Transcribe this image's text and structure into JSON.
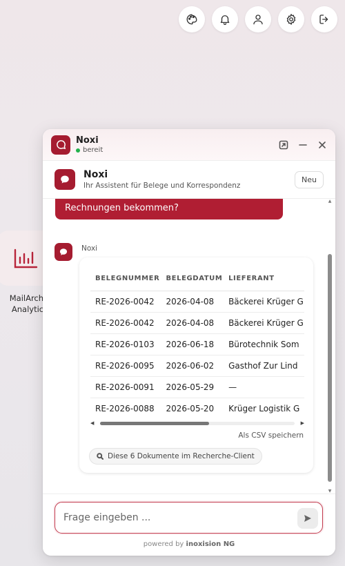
{
  "topbar": {
    "icons": [
      "palette-icon",
      "bell-icon",
      "user-icon",
      "gear-icon",
      "logout-icon"
    ]
  },
  "desktop": {
    "app_tile": {
      "label_line1": "MailArchi",
      "label_line2": "Analytic",
      "icon": "bar-chart-icon"
    }
  },
  "chat": {
    "header": {
      "title": "Noxi",
      "status": "bereit"
    },
    "assistant": {
      "name": "Noxi",
      "subtitle": "Ihr Assistent für Belege und Korrespondenz",
      "new_button": "Neu"
    },
    "user_message": "Rechnungen bekommen?",
    "bot_name": "Noxi",
    "table": {
      "columns": [
        "BELEGNUMMER",
        "BELEGDATUM",
        "LIEFERANT"
      ],
      "rows": [
        [
          "RE-2026-0042",
          "2026-04-08",
          "Bäckerei Krüger G"
        ],
        [
          "RE-2026-0042",
          "2026-04-08",
          "Bäckerei Krüger G"
        ],
        [
          "RE-2026-0103",
          "2026-06-18",
          "Bürotechnik Som"
        ],
        [
          "RE-2026-0095",
          "2026-06-02",
          "Gasthof Zur Lind"
        ],
        [
          "RE-2026-0091",
          "2026-05-29",
          "—"
        ],
        [
          "RE-2026-0088",
          "2026-05-20",
          "Krüger Logistik G"
        ]
      ]
    },
    "csv_link": "Als CSV speichern",
    "research_button": "Diese 6 Dokumente im Recherche-Client",
    "input_placeholder": "Frage eingeben ...",
    "powered_prefix": "powered by",
    "powered_brand": "inoxision NG"
  },
  "colors": {
    "accent": "#a51c30",
    "status_ok": "#22b14c"
  }
}
